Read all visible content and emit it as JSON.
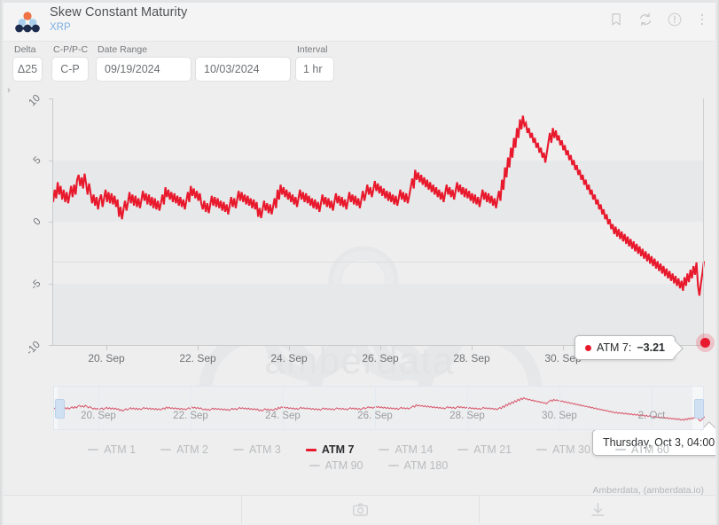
{
  "header": {
    "logo_name": "amberdata-molecule-logo",
    "title": "Skew Constant Maturity",
    "subtitle": "XRP",
    "icons": [
      {
        "name": "bookmark-icon",
        "label": "Bookmark"
      },
      {
        "name": "refresh-icon",
        "label": "Refresh"
      },
      {
        "name": "info-circle-icon",
        "label": "Info"
      },
      {
        "name": "kebab-menu-icon",
        "label": "More options"
      }
    ]
  },
  "controls": {
    "delta": {
      "label": "Delta",
      "value": "Δ25"
    },
    "cp_pc": {
      "label": "C-P/P-C",
      "value": "C-P"
    },
    "date_range": {
      "label": "Date Range",
      "start": "09/19/2024",
      "end": "10/03/2024"
    },
    "interval": {
      "label": "Interval",
      "value": "1 hr"
    },
    "expand_chevron": "›"
  },
  "tooltips": {
    "series": {
      "label": "ATM 7:",
      "value": "−3.21"
    },
    "date": "Thursday, Oct 3, 04:00"
  },
  "watermark": {
    "text": "amberdata",
    "logo_name": "xrp-ripple-logo-watermark"
  },
  "legend": {
    "items": [
      {
        "label": "ATM 1",
        "active": false,
        "color": "#cdcfd1"
      },
      {
        "label": "ATM 2",
        "active": false,
        "color": "#cdcfd1"
      },
      {
        "label": "ATM 3",
        "active": false,
        "color": "#cdcfd1"
      },
      {
        "label": "ATM 7",
        "active": true,
        "color": "#e8192c"
      },
      {
        "label": "ATM 14",
        "active": false,
        "color": "#cdcfd1"
      },
      {
        "label": "ATM 21",
        "active": false,
        "color": "#cdcfd1"
      },
      {
        "label": "ATM 30",
        "active": false,
        "color": "#cdcfd1"
      },
      {
        "label": "ATM 60",
        "active": false,
        "color": "#cdcfd1"
      },
      {
        "label": "ATM 90",
        "active": false,
        "color": "#cdcfd1"
      },
      {
        "label": "ATM 180",
        "active": false,
        "color": "#cdcfd1"
      }
    ]
  },
  "credits": "Amberdata, (amberdata.io)",
  "footer": {
    "buttons": [
      {
        "name": "screenshot-camera-button",
        "label": "Take screenshot"
      },
      {
        "name": "download-button",
        "label": "Download"
      }
    ]
  },
  "colors": {
    "series_red": "#e8192c",
    "accent_blue": "#7fb0e0",
    "plot_band": "#e7e8e9",
    "background": "#eeeeef"
  },
  "chart_data": {
    "type": "line",
    "title": "Skew Constant Maturity",
    "subtitle": "XRP",
    "xlabel": "",
    "ylabel": "",
    "ylim": [
      -10,
      10
    ],
    "yticks": [
      10,
      5,
      0,
      -5,
      -10
    ],
    "xticks": [
      "20. Sep",
      "22. Sep",
      "24. Sep",
      "26. Sep",
      "28. Sep",
      "30. Sep"
    ],
    "navigator_xticks": [
      "20. Sep",
      "22. Sep",
      "24. Sep",
      "26. Sep",
      "28. Sep",
      "30. Sep",
      "2. Oct"
    ],
    "grid": true,
    "legend_position": "bottom",
    "highlighted_point": {
      "series": "ATM 7",
      "x": "Thursday, Oct 3, 04:00",
      "y": -3.21
    },
    "series": [
      {
        "name": "ATM 7",
        "color": "#e8192c",
        "visible": true,
        "x_start": "09/19/2024",
        "x_end": "10/03/2024",
        "values": [
          1.6,
          2.6,
          1.9,
          3.2,
          2.2,
          2.9,
          1.8,
          2.6,
          1.6,
          2.4,
          1.5,
          2.2,
          2.9,
          2.0,
          3.0,
          2.2,
          3.4,
          3.8,
          2.9,
          3.6,
          2.7,
          3.9,
          3.1,
          2.2,
          3.1,
          2.3,
          1.5,
          2.2,
          1.3,
          2.0,
          1.0,
          1.8,
          2.2,
          1.2,
          1.9,
          2.6,
          1.6,
          2.4,
          1.5,
          2.3,
          1.4,
          2.1,
          1.2,
          1.8,
          0.4,
          1.2,
          0.2,
          1.0,
          1.7,
          0.9,
          1.6,
          2.4,
          1.5,
          2.2,
          1.3,
          2.1,
          1.2,
          1.9,
          1.1,
          1.8,
          2.5,
          1.7,
          2.3,
          1.4,
          2.2,
          1.3,
          2.0,
          1.1,
          1.9,
          1.0,
          1.7,
          0.9,
          1.5,
          2.2,
          1.4,
          2.8,
          2.0,
          2.6,
          1.8,
          2.4,
          1.6,
          2.3,
          1.5,
          2.1,
          1.3,
          2.0,
          1.2,
          1.8,
          1.0,
          1.7,
          2.4,
          1.6,
          2.9,
          2.1,
          2.7,
          1.9,
          2.5,
          1.7,
          2.3,
          1.5,
          1.0,
          1.7,
          0.8,
          1.5,
          0.7,
          1.4,
          2.1,
          1.3,
          2.0,
          1.2,
          1.9,
          1.1,
          1.7,
          0.9,
          1.6,
          0.8,
          1.4,
          0.6,
          1.3,
          2.0,
          1.2,
          1.9,
          1.1,
          1.8,
          2.5,
          1.7,
          2.4,
          1.6,
          2.2,
          1.4,
          2.1,
          1.3,
          1.9,
          1.1,
          1.8,
          1.0,
          1.6,
          0.4,
          1.1,
          0.3,
          1.0,
          1.7,
          0.9,
          1.5,
          0.7,
          1.4,
          0.6,
          1.2,
          1.9,
          1.1,
          2.6,
          1.8,
          3.0,
          2.2,
          2.8,
          2.0,
          2.6,
          1.8,
          2.4,
          1.6,
          2.2,
          1.4,
          2.0,
          1.2,
          1.9,
          2.6,
          1.8,
          2.4,
          1.6,
          2.3,
          1.5,
          2.1,
          1.3,
          1.9,
          1.1,
          1.8,
          1.0,
          1.6,
          0.8,
          1.5,
          2.2,
          1.4,
          2.0,
          1.2,
          1.9,
          1.1,
          1.7,
          0.9,
          1.6,
          2.3,
          1.5,
          2.1,
          1.3,
          2.0,
          1.2,
          1.8,
          1.0,
          1.7,
          2.4,
          1.6,
          2.2,
          1.4,
          2.1,
          1.3,
          1.9,
          1.1,
          1.8,
          2.5,
          1.7,
          2.3,
          3.0,
          2.2,
          2.8,
          2.0,
          2.6,
          3.3,
          2.5,
          3.1,
          2.3,
          2.9,
          2.1,
          2.7,
          1.9,
          2.5,
          1.7,
          2.4,
          1.6,
          2.2,
          1.4,
          2.1,
          1.3,
          1.9,
          2.6,
          1.8,
          2.4,
          1.6,
          2.3,
          1.5,
          2.1,
          2.8,
          3.5,
          2.7,
          4.2,
          3.4,
          4.0,
          3.2,
          3.8,
          3.0,
          3.6,
          2.8,
          3.4,
          2.6,
          3.2,
          2.4,
          3.0,
          2.2,
          2.8,
          2.0,
          2.6,
          1.8,
          2.4,
          1.6,
          2.3,
          3.0,
          2.2,
          2.8,
          2.0,
          2.6,
          1.8,
          2.5,
          3.2,
          2.4,
          3.0,
          2.2,
          2.8,
          2.0,
          2.7,
          1.9,
          2.5,
          1.7,
          2.3,
          1.5,
          2.2,
          1.4,
          2.0,
          1.2,
          1.9,
          2.6,
          1.8,
          2.4,
          1.6,
          2.3,
          1.5,
          2.1,
          1.3,
          1.9,
          1.1,
          1.8,
          2.5,
          1.7,
          3.4,
          2.6,
          4.4,
          3.6,
          5.2,
          4.4,
          6.0,
          5.2,
          6.8,
          6.0,
          7.6,
          6.8,
          8.3,
          7.5,
          8.6,
          7.8,
          8.0,
          7.2,
          7.6,
          6.8,
          7.2,
          6.4,
          6.8,
          6.0,
          6.4,
          5.6,
          6.0,
          5.2,
          5.6,
          4.8,
          5.6,
          6.4,
          7.2,
          6.4,
          7.6,
          6.8,
          7.4,
          6.6,
          7.0,
          6.2,
          6.6,
          5.8,
          6.2,
          5.4,
          5.8,
          5.0,
          5.4,
          4.6,
          5.0,
          4.2,
          4.6,
          3.8,
          4.2,
          3.4,
          3.8,
          3.0,
          3.4,
          2.6,
          3.0,
          2.2,
          2.6,
          1.8,
          2.2,
          1.4,
          1.8,
          1.0,
          1.4,
          0.6,
          1.0,
          0.2,
          0.6,
          -0.2,
          0.2,
          -0.6,
          -0.2,
          -1.0,
          -0.4,
          -1.2,
          -0.6,
          -1.4,
          -0.8,
          -1.6,
          -1.0,
          -1.8,
          -1.2,
          -2.0,
          -1.4,
          -2.2,
          -1.6,
          -2.4,
          -1.8,
          -2.6,
          -2.0,
          -2.8,
          -2.2,
          -3.0,
          -2.4,
          -3.2,
          -2.6,
          -3.4,
          -2.8,
          -3.6,
          -3.0,
          -3.8,
          -3.2,
          -4.0,
          -3.4,
          -4.2,
          -3.6,
          -4.4,
          -3.8,
          -4.6,
          -4.0,
          -4.8,
          -4.2,
          -5.0,
          -4.4,
          -5.2,
          -4.6,
          -5.4,
          -4.8,
          -5.6,
          -4.5,
          -5.2,
          -4.2,
          -4.9,
          -3.9,
          -4.6,
          -3.6,
          -4.3,
          -3.3,
          -5.2,
          -6.0,
          -5.0,
          -4.2,
          -3.21
        ]
      }
    ]
  }
}
